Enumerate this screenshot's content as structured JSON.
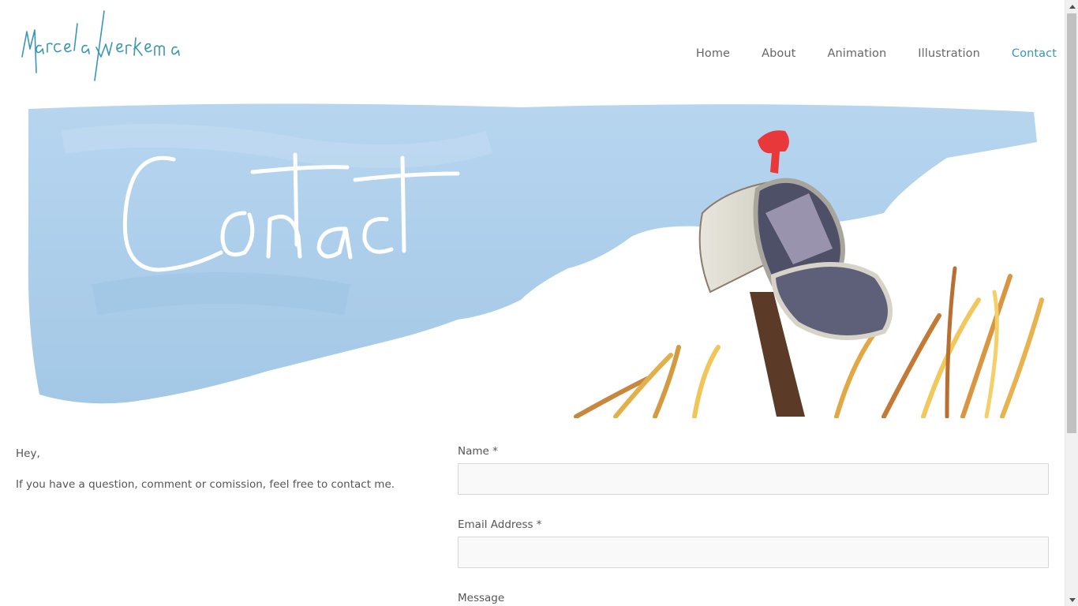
{
  "site": {
    "logo_text": "Marcela Werkema"
  },
  "nav": {
    "items": [
      {
        "label": "Home",
        "active": false
      },
      {
        "label": "About",
        "active": false
      },
      {
        "label": "Animation",
        "active": false
      },
      {
        "label": "Illustration",
        "active": false
      },
      {
        "label": "Contact",
        "active": true
      }
    ]
  },
  "banner": {
    "title": "Contact",
    "icon": "mailbox-illustration"
  },
  "intro": {
    "greeting": "Hey,",
    "message": "If you have a question, comment or comission, feel free to contact me."
  },
  "form": {
    "name_label": "Name *",
    "name_value": "",
    "email_label": "Email Address *",
    "email_value": "",
    "message_label": "Message"
  },
  "colors": {
    "accent": "#3a97b3",
    "nav_text": "#666666",
    "sky": "#a9cdea",
    "mailbox_flag": "#e8383a"
  }
}
